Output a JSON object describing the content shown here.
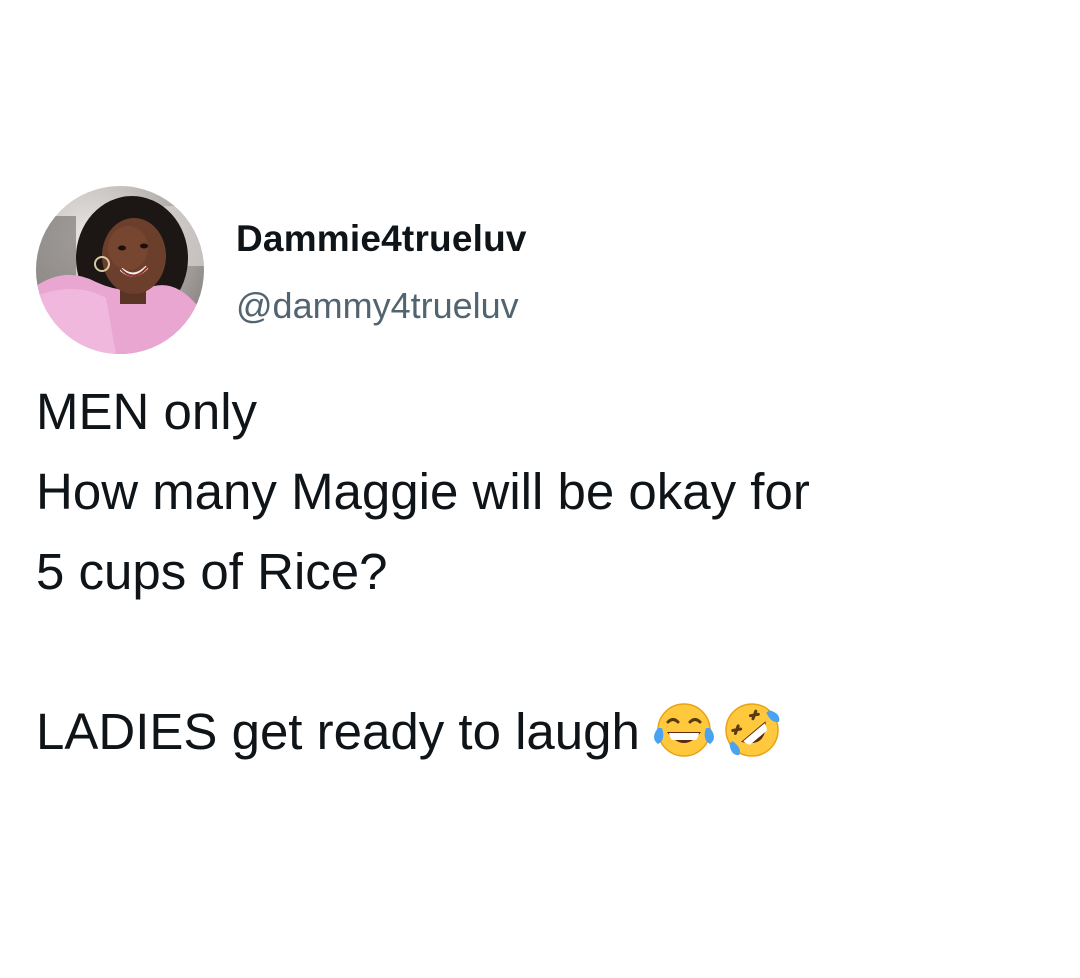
{
  "author": {
    "display_name": "Dammie4trueluv",
    "handle": "@dammy4trueluv",
    "avatar_icon": "profile-photo"
  },
  "tweet": {
    "line_1": "MEN only",
    "line_2": "How many Maggie will be okay for",
    "line_3": "5 cups of Rice?",
    "line_4": "LADIES get ready to laugh",
    "emojis": [
      "face-with-tears-of-joy-icon",
      "rolling-on-the-floor-laughing-icon"
    ]
  },
  "colors": {
    "text": "#0f1419",
    "secondary_text": "#536471",
    "background": "#ffffff"
  }
}
